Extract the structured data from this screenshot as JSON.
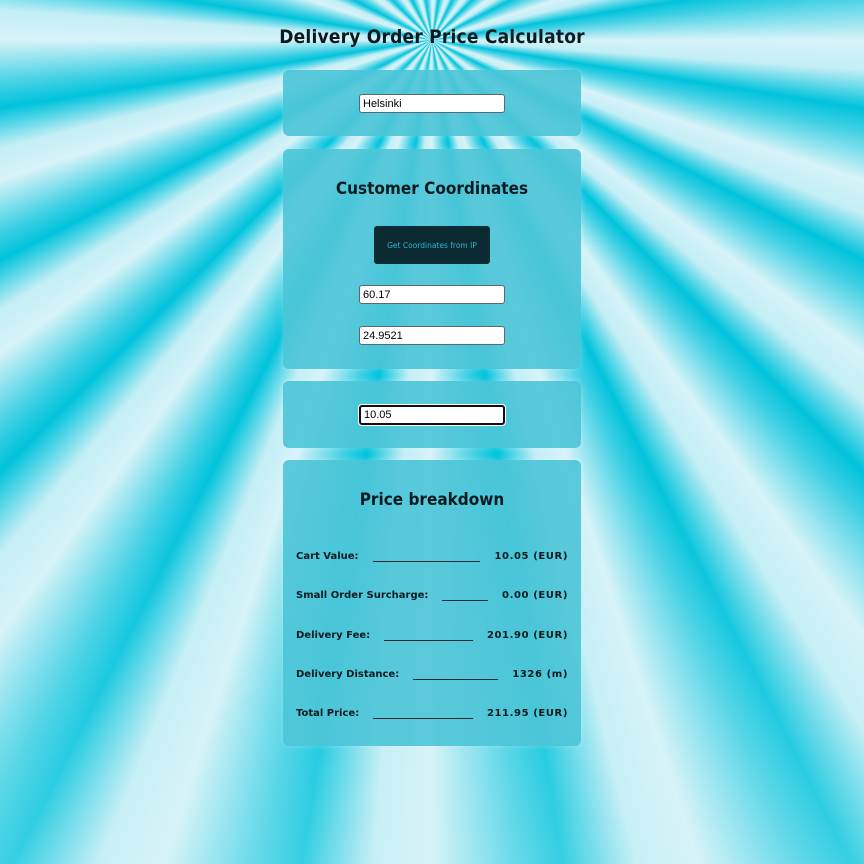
{
  "page_title": "Delivery Order Price Calculator",
  "venue": {
    "value": "Helsinki"
  },
  "coordinates": {
    "title": "Customer Coordinates",
    "button_label": "Get Coordinates from IP",
    "latitude": "60.17",
    "longitude": "24.9521"
  },
  "cart": {
    "value": "10.05"
  },
  "breakdown": {
    "title": "Price breakdown",
    "rows": [
      {
        "label": "Cart Value:",
        "value": "10.05 (EUR)"
      },
      {
        "label": "Small Order Surcharge:",
        "value": "0.00 (EUR)"
      },
      {
        "label": "Delivery Fee:",
        "value": "201.90 (EUR)"
      },
      {
        "label": "Delivery Distance:",
        "value": "1326 (m)"
      },
      {
        "label": "Total Price:",
        "value": "211.95 (EUR)"
      }
    ]
  }
}
